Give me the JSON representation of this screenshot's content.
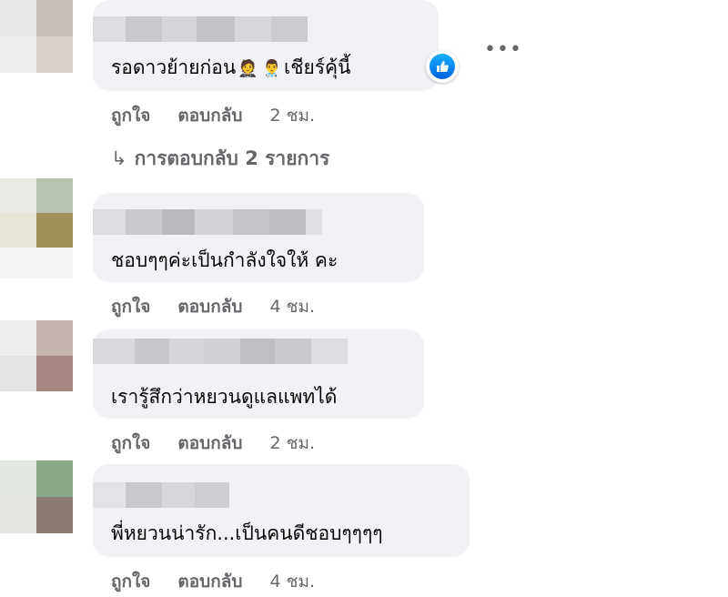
{
  "comments": [
    {
      "text": "รอดาวย้ายก่อน",
      "emoji1": "🤵",
      "emoji2": "👨‍⚕️",
      "text2": "เชียร์คุ้นี้",
      "like": "ถูกใจ",
      "reply": "ตอบกลับ",
      "time": "2 ชม."
    },
    {
      "text": "ชอบๆๆค่ะเป็นกำลังใจให้ คะ",
      "like": "ถูกใจ",
      "reply": "ตอบกลับ",
      "time": "4 ชม."
    },
    {
      "text": "เรารู้สึกว่าหยวนดูแลแพทได้",
      "like": "ถูกใจ",
      "reply": "ตอบกลับ",
      "time": "2 ชม."
    },
    {
      "text": "พี่หยวนน่ารัก...เป็นคนดีชอบๆๆๆๆ",
      "like": "ถูกใจ",
      "reply": "ตอบกลับ",
      "time": "4 ชม."
    }
  ],
  "replies_link": "การตอบกลับ 2 รายการ",
  "more_label": "•••",
  "colors": {
    "bubble": "#f0f2f5",
    "secondary_text": "#65676b",
    "like_blue": "#0866ff"
  }
}
